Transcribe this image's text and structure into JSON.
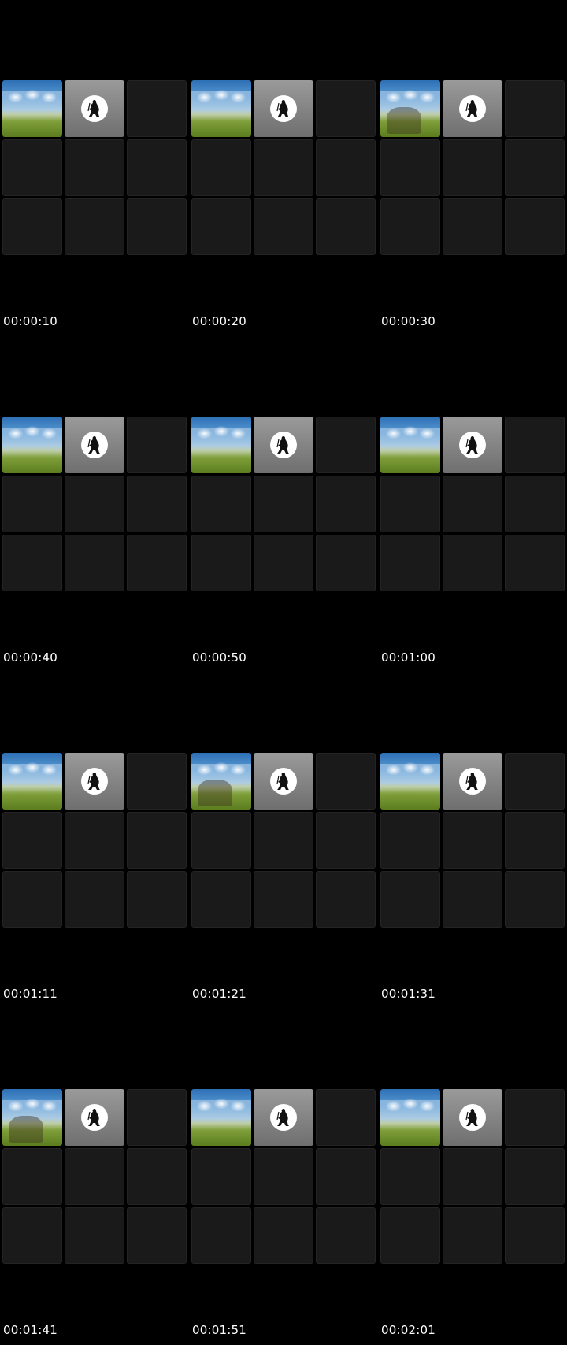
{
  "frames": [
    {
      "timestamp": "00:00:10"
    },
    {
      "timestamp": "00:00:20"
    },
    {
      "timestamp": "00:00:30"
    },
    {
      "timestamp": "00:00:40"
    },
    {
      "timestamp": "00:00:50"
    },
    {
      "timestamp": "00:01:00"
    },
    {
      "timestamp": "00:01:11"
    },
    {
      "timestamp": "00:01:21"
    },
    {
      "timestamp": "00:01:31"
    },
    {
      "timestamp": "00:01:41"
    },
    {
      "timestamp": "00:01:51"
    },
    {
      "timestamp": "00:02:01"
    }
  ],
  "tile_icons": {
    "first": "stadium-thumbnail",
    "second": "horse-rider-logo-icon"
  },
  "colors": {
    "background": "#000000",
    "empty_tile": "#1a1a1a",
    "timestamp_text": "#ffffff"
  }
}
